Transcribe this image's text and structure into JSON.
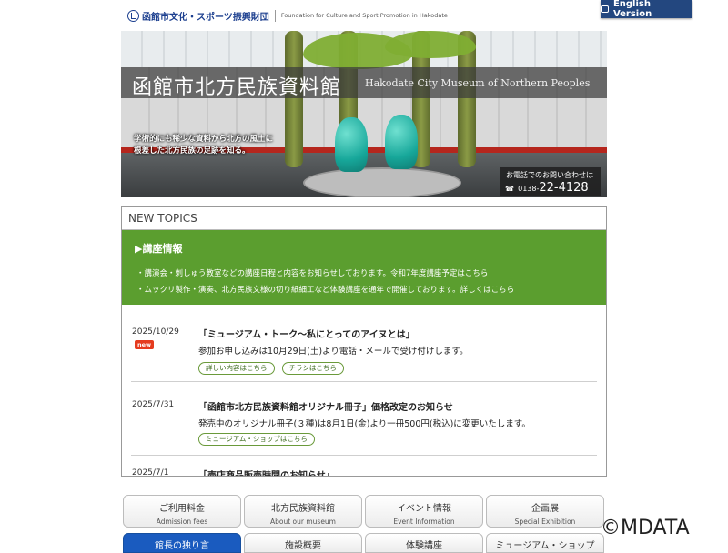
{
  "header": {
    "org_jp": "函館市文化・スポーツ振興財団",
    "org_en": "Foundation for Culture and Sport Promotion in Hakodate",
    "english_button": "English Version"
  },
  "hero": {
    "title_jp": "函館市北方民族資料館",
    "title_en": "Hakodate City Museum of Northern Peoples",
    "tagline_1": "学術的にも稀少な資料から北方の風土に",
    "tagline_2": "根差した北方民族の足跡を知る。",
    "phone_caption": "お電話でのお問い合わせは",
    "phone_area": "0138-",
    "phone_number": "22-4128"
  },
  "topics": {
    "title": "NEW TOPICS",
    "lecture": {
      "heading": "▶講座情報",
      "line_1": "・講演会・刺しゅう教室などの講座日程と内容をお知らせしております。令和7年度講座予定はこちら",
      "line_2": "・ムックリ製作・演奏、北方民族文様の切り紙細工など体験講座を通年で開催しております。詳しくはこちら"
    },
    "items": [
      {
        "date": "2025/10/29",
        "badge": "new",
        "headline": "「ミュージアム・トーク～私にとってのアイヌとは」",
        "body": "参加お申し込みは10月29日(土)より電話・メールで受け付けします。",
        "links": [
          "詳しい内容はこちら",
          "チラシはこちら"
        ]
      },
      {
        "date": "2025/7/31",
        "headline": "「函館市北方民族資料館オリジナル冊子」価格改定のお知らせ",
        "body": "発売中のオリジナル冊子(３種)は8月1日(金)より一冊500円(税込)に変更いたします。",
        "links": [
          "ミュージアム・ショップはこちら"
        ]
      },
      {
        "date": "2025/7/1",
        "headline": "「売店商品販売時間のお知らせ」"
      }
    ]
  },
  "nav": [
    {
      "jp": "ご利用料金",
      "en": "Admission fees"
    },
    {
      "jp": "北方民族資料館",
      "en": "About our museum"
    },
    {
      "jp": "イベント情報",
      "en": "Event Information"
    },
    {
      "jp": "企画展",
      "en": "Special Exhibition"
    }
  ],
  "nav2": [
    "館長の独り言",
    "施設概要",
    "体験講座",
    "ミュージアム・ショップ"
  ],
  "copyright": "©MDATA"
}
